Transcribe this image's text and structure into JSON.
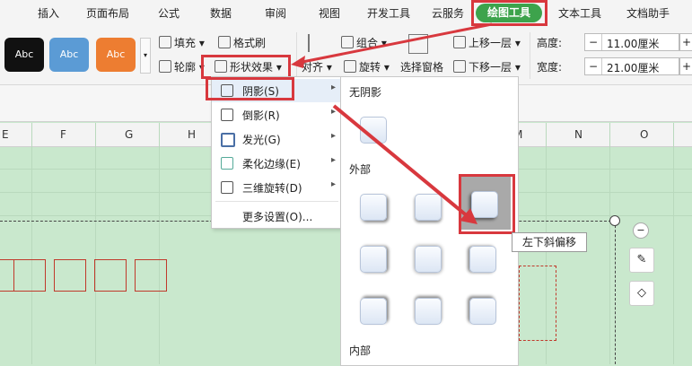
{
  "menu": {
    "tabs": [
      "页面布局",
      "公式",
      "数据",
      "审阅",
      "视图",
      "开发工具",
      "云服务",
      "绘图工具",
      "文本工具",
      "文档助手"
    ],
    "first_tab": "插入",
    "active_tab": "绘图工具"
  },
  "ribbon": {
    "presets": [
      {
        "label": "Abc",
        "color": "#111111"
      },
      {
        "label": "Abc",
        "color": "#5b9bd5"
      },
      {
        "label": "Abc",
        "color": "#ed7d31"
      }
    ],
    "fill": "填充",
    "format_painter": "格式刷",
    "outline": "轮廓",
    "shape_effect": "形状效果",
    "group": "组合",
    "align": "对齐",
    "rotate": "旋转",
    "selection_pane": "选择窗格",
    "bring_forward": "上移一层",
    "send_backward": "下移一层",
    "height_label": "高度:",
    "height_value": "11.00厘米",
    "width_label": "宽度:",
    "width_value": "21.00厘米"
  },
  "sheet": {
    "columns": [
      "E",
      "F",
      "G",
      "H",
      "M",
      "N",
      "O"
    ]
  },
  "dropdown": {
    "items": [
      {
        "label": "阴影(S)",
        "has_submenu": true
      },
      {
        "label": "倒影(R)",
        "has_submenu": true
      },
      {
        "label": "发光(G)",
        "has_submenu": true
      },
      {
        "label": "柔化边缘(E)",
        "has_submenu": true
      },
      {
        "label": "三维旋转(D)",
        "has_submenu": true
      },
      {
        "label": "更多设置(O)...",
        "has_submenu": false
      }
    ]
  },
  "submenu": {
    "no_shadow": "无阴影",
    "outer": "外部",
    "inner": "内部",
    "tooltip": "左下斜偏移"
  },
  "colors": {
    "active_tab": "#3da34c",
    "highlight": "#d8383e",
    "sheet_bg": "#c9e8cd"
  }
}
